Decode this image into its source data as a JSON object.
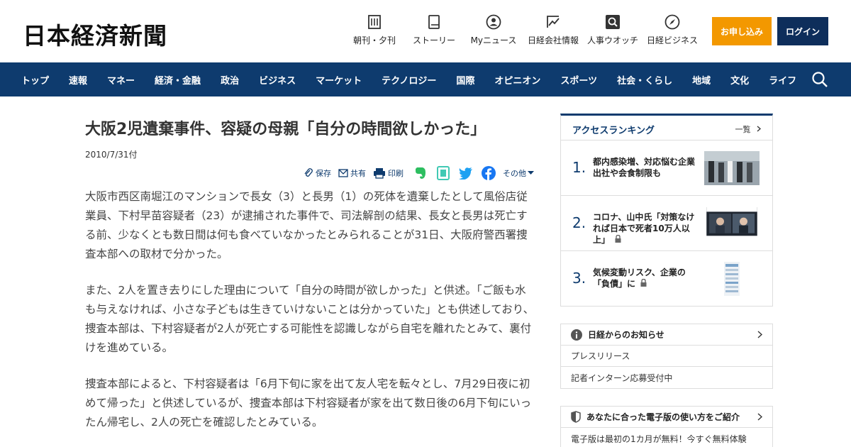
{
  "header": {
    "logo": "日本経済新聞",
    "nav": [
      {
        "label": "朝刊・夕刊",
        "icon": "newspaper-icon"
      },
      {
        "label": "ストーリー",
        "icon": "book-icon"
      },
      {
        "label": "Myニュース",
        "icon": "user-icon"
      },
      {
        "label": "日経会社情報",
        "icon": "chart-icon"
      },
      {
        "label": "人事ウオッチ",
        "icon": "search-person-icon"
      },
      {
        "label": "日経ビジネス",
        "icon": "compass-icon"
      }
    ],
    "apply_label": "お申し込み",
    "login_label": "ログイン"
  },
  "gnav": {
    "items": [
      "トップ",
      "速報",
      "マネー",
      "経済・金融",
      "政治",
      "ビジネス",
      "マーケット",
      "テクノロジー",
      "国際",
      "オピニオン",
      "スポーツ",
      "社会・くらし",
      "地域",
      "文化",
      "ライフ"
    ]
  },
  "article": {
    "title": "大阪2児遺棄事件、容疑の母親「自分の時間欲しかった」",
    "date": "2010/7/31付",
    "tools": {
      "save": "保存",
      "share": "共有",
      "print": "印刷",
      "more": "その他"
    },
    "paragraphs": [
      "大阪市西区南堀江のマンションで長女（3）と長男（1）の死体を遺棄したとして風俗店従業員、下村早苗容疑者（23）が逮捕された事件で、司法解剖の結果、長女と長男は死亡する前、少なくとも数日間は何も食べていなかったとみられることが31日、大阪府警西署捜査本部への取材で分かった。",
      "また、2人を置き去りにした理由について「自分の時間が欲しかった」と供述。「ご飯も水も与えなければ、小さな子どもは生きていけないことは分かっていた」とも供述しており、捜査本部は、下村容疑者が2人が死亡する可能性を認識しながら自宅を離れたとみて、裏付けを進めている。",
      "捜査本部によると、下村容疑者は「6月下旬に家を出て友人宅を転々とし、7月29日夜に初めて帰った」と供述しているが、捜査本部は下村容疑者が家を出て数日後の6月下旬にいったん帰宅し、2人の死亡を確認したとみている。"
    ]
  },
  "ranking": {
    "title": "アクセスランキング",
    "more": "一覧",
    "items": [
      {
        "num": "1.",
        "text": "都内感染増、対応悩む企業　出社や会食制限も",
        "locked": false
      },
      {
        "num": "2.",
        "text": "コロナ、山中氏「対策なければ日本で死者10万人以上」",
        "locked": true
      },
      {
        "num": "3.",
        "text": "気候変動リスク、企業の「負債」に",
        "locked": true
      }
    ]
  },
  "notice": {
    "title": "日経からのお知らせ",
    "rows": [
      "プレスリリース",
      "記者インターン応募受付中"
    ]
  },
  "digital": {
    "title": "あなたに合った電子版の使い方をご紹介",
    "rows": [
      "電子版は最初の1カ月が無料！今すぐ無料体験"
    ]
  },
  "colors": {
    "navy": "#0e3b6e",
    "orange": "#f39800",
    "login": "#0e2e5b"
  }
}
